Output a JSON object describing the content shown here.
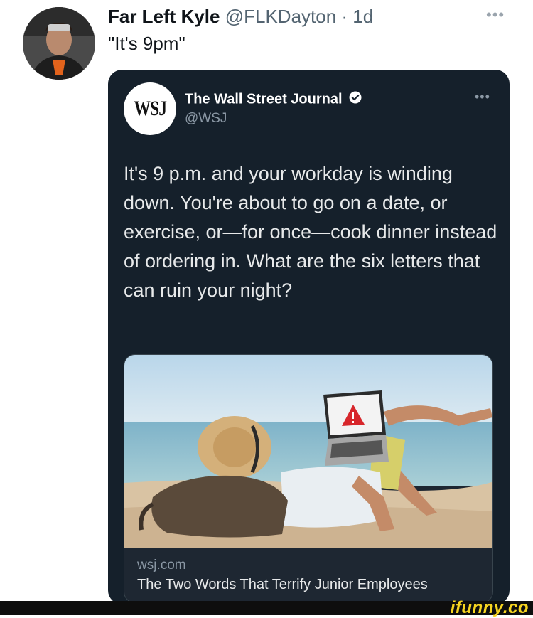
{
  "tweet": {
    "author_name": "Far Left Kyle",
    "author_handle": "@FLKDayton · 1d",
    "more_icon": "more-icon",
    "text": "\"It's 9pm\""
  },
  "quoted_tweet": {
    "logo_text": "WSJ",
    "author_name": "The Wall Street Journal",
    "author_handle": "@WSJ",
    "verified_icon": "verified-badge-icon",
    "text": "It's 9 p.m. and your workday is winding down. You're about to go on a date, or exercise, or—for once—cook dinner instead of ordering in. What are the six letters that can ruin your night?",
    "link_card": {
      "domain": "wsj.com",
      "title": "The Two Words That Terrify Junior Employees"
    }
  },
  "watermark": {
    "brand": "ifunny.co"
  },
  "colors": {
    "card_background": "#15202b",
    "page_background": "#ffffff",
    "watermark": "#f7d520"
  }
}
